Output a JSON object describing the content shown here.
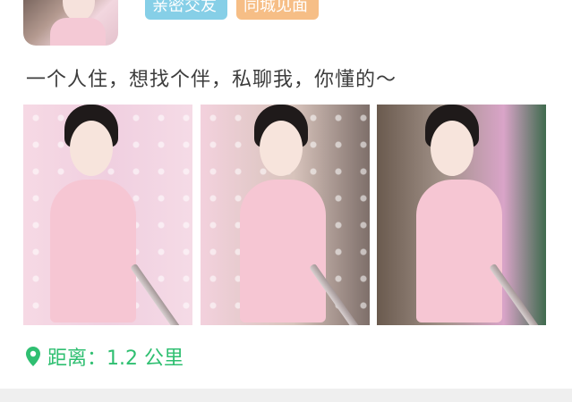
{
  "tags": {
    "friendship": "亲密交友",
    "meetup": "同城见面"
  },
  "post": {
    "text": "一个人住，想找个伴，私聊我，你懂的～"
  },
  "photos": [
    {
      "id": "photo-1"
    },
    {
      "id": "photo-2"
    },
    {
      "id": "photo-3"
    }
  ],
  "distance": {
    "label": "距离：1.2 公里",
    "icon": "location-pin-icon",
    "color": "#2fbf71"
  },
  "colors": {
    "tag_friendship_bg": "#86cfe7",
    "tag_meetup_bg": "#f6be86",
    "footer_band": "#efefef"
  }
}
